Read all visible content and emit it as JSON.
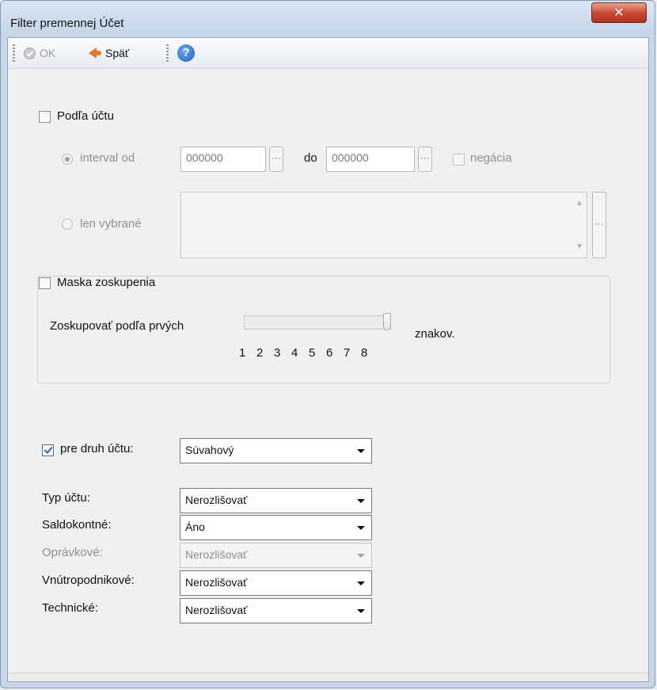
{
  "window": {
    "title": "Filter premennej Účet",
    "close_glyph": "✕"
  },
  "toolbar": {
    "ok_label": "OK",
    "back_label": "Späť",
    "help_glyph": "?"
  },
  "account_filter": {
    "label": "Podľa účtu",
    "checked": false,
    "interval": {
      "label": "interval od",
      "from_value": "000000",
      "to_label": "do",
      "to_value": "000000",
      "negation_label": "negácia",
      "browse_glyph": "···"
    },
    "selected_only": {
      "label": "len vybrané",
      "browse_glyph": "···"
    }
  },
  "group_mask": {
    "label": "Maska zoskupenia",
    "checked": false,
    "slider_label": "Zoskupovať podľa prvých",
    "slider_value": 8,
    "ticks": [
      "1",
      "2",
      "3",
      "4",
      "5",
      "6",
      "7",
      "8"
    ],
    "suffix": "znakov."
  },
  "account_kind": {
    "label": "pre druh účtu:",
    "checked": true,
    "value": "Súvahový"
  },
  "fields": [
    {
      "label": "Typ účtu:",
      "value": "Nerozlišovať",
      "disabled": false
    },
    {
      "label": "Saldokontné:",
      "value": "Áno",
      "disabled": false
    },
    {
      "label": "Oprávkové:",
      "value": "Nerozlišovať",
      "disabled": true
    },
    {
      "label": "Vnútropodnikové:",
      "value": "Nerozlišovať",
      "disabled": false
    },
    {
      "label": "Technické:",
      "value": "Nerozlišovať",
      "disabled": false
    }
  ]
}
